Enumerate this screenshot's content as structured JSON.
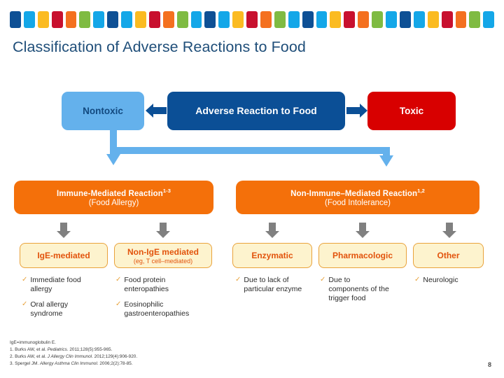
{
  "colorbar": {
    "name": "decorative-color-strip",
    "colors": [
      "#0E5095",
      "#14A7E8",
      "#FBBB21",
      "#C8102E",
      "#F4701F",
      "#7FBB42",
      "#14A7E8",
      "#0E5095",
      "#14A7E8",
      "#FBBB21",
      "#C8102E",
      "#F4701F",
      "#7FBB42",
      "#14A7E8",
      "#0E5095",
      "#14A7E8",
      "#FBBB21",
      "#C8102E",
      "#F4701F",
      "#7FBB42",
      "#14A7E8",
      "#0E5095",
      "#14A7E8",
      "#FBBB21",
      "#C8102E",
      "#F4701F",
      "#7FBB42",
      "#14A7E8",
      "#0E5095",
      "#14A7E8",
      "#FBBB21",
      "#C8102E",
      "#F4701F",
      "#7FBB42",
      "#14A7E8"
    ]
  },
  "slide": {
    "title": "Classification of Adverse Reactions to Food",
    "page_number": "8"
  },
  "row1": {
    "nontoxic": "Nontoxic",
    "adverse": "Adverse Reaction to Food",
    "toxic": "Toxic",
    "arrow_left_color": "#0B4F96",
    "arrow_right_color": "#0B4F96"
  },
  "row2": {
    "immune": {
      "line1": "Immune-Mediated Reaction",
      "sup": "1-3",
      "line2": "(Food Allergy)"
    },
    "nonimmune": {
      "line1": "Non-Immune–Mediated Reaction",
      "sup": "1,2",
      "line2": "(Food Intolerance)"
    },
    "box_color": "#F4700A",
    "connector_color": "#64B1EC"
  },
  "row3": {
    "arrow_color": "#808080",
    "box_fill": "#FDF3CE",
    "box_border": "#E9A23B",
    "text_color": "#E2530C",
    "boxes": [
      {
        "title": "IgE-mediated",
        "subtitle": ""
      },
      {
        "title": "Non-IgE mediated",
        "subtitle": "(eg, T cell–mediated)"
      },
      {
        "title": "Enzymatic",
        "subtitle": ""
      },
      {
        "title": "Pharmacologic",
        "subtitle": ""
      },
      {
        "title": "Other",
        "subtitle": ""
      }
    ]
  },
  "bullets": {
    "check_glyph": "✓",
    "ige": [
      "Immediate food allergy",
      "Oral allergy syndrome"
    ],
    "nonige": [
      "Food protein enteropathies",
      "Eosinophilic gastroenteropathies"
    ],
    "enzymatic": [
      "Due to lack of particular enzyme"
    ],
    "pharmacologic": [
      "Due to components of the trigger food"
    ],
    "other": [
      "Neurologic"
    ]
  },
  "footnotes": {
    "abbrev": "IgE=immunoglobulin E.",
    "ref1_pre": "1. Burks AW, et al. ",
    "ref1_journal": "Pediatrics",
    "ref1_post": ". 2011;128(5):955-965.",
    "ref2_pre": "2. Burks AW, et al. ",
    "ref2_journal": "J Allergy Clin Immunol",
    "ref2_post": ". 2012;129(4):906-920.",
    "ref3_pre": "3. Spergel JM. ",
    "ref3_journal": "Allergy Asthma Clin Immunol",
    "ref3_post": ". 2006;2(2):78-85."
  }
}
